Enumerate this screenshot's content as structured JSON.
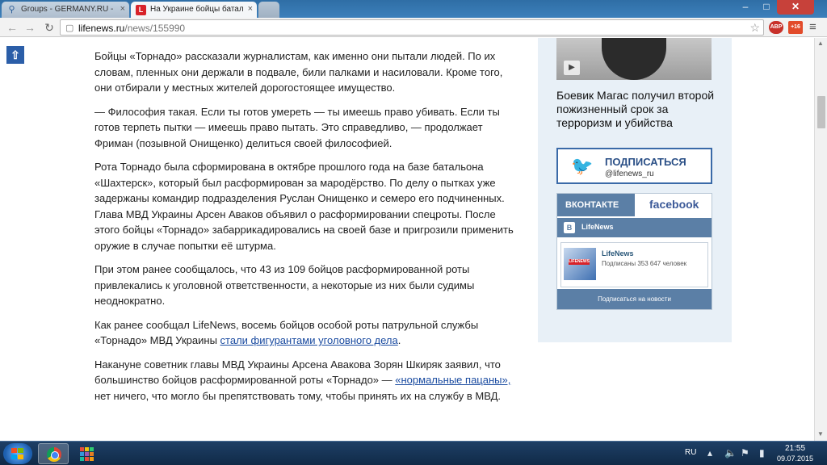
{
  "browser": {
    "tabs": [
      {
        "label": "Groups - GERMANY.RU - ",
        "favicon": "groups-icon"
      },
      {
        "label": "На Украине бойцы батал",
        "favicon": "L"
      }
    ],
    "url_host": "lifenews.ru",
    "url_path": "/news/155990",
    "extensions": {
      "adblock": "ABP",
      "plus_badge": "+16"
    }
  },
  "article": {
    "paragraphs": [
      "Бойцы «Торнадо» рассказали журналистам, как именно они пытали людей. По их словам, пленных они держали в подвале, били палками и насиловали. Кроме того, они отбирали у местных жителей дорогостоящее имущество.",
      "— Философия такая. Если ты готов умереть — ты имеешь право убивать. Если ты готов терпеть пытки — имеешь право пытать. Это справедливо, — продолжает Фриман (позывной Онищенко) делиться своей философией.",
      "Рота Торнадо была сформирована в октябре прошлого года на базе батальона «Шахтерск», который был расформирован за мародёрство. По делу о пытках уже задержаны командир подразделения Руслан Онищенко и семеро его подчиненных. Глава МВД Украины Арсен Аваков объявил о расформировании спецроты. После этого бойцы «Торнадо» забаррикадировались на своей базе и пригрозили применить оружие в случае попытки её штурма.",
      "При этом ранее сообщалось, что 43 из 109 бойцов расформированной роты привлекались к уголовной ответственности, а некоторые из них были судимы неоднократно."
    ],
    "p5_pre": "Как ранее сообщал LifeNews, восемь бойцов особой роты патрульной службы «Торнадо» МВД Украины ",
    "p5_link": "стали фигурантами уголовного дела",
    "p5_post": ".",
    "p6_pre": "Накануне советник главы МВД Украины Арсена Авакова Зорян Шкиряк заявил, что большинство бойцов расформированной роты «Торнадо» — ",
    "p6_link": "«нормальные пацаны», ",
    "p6_post": "нет ничего, что могло бы препятствовать тому, чтобы принять их на службу в МВД."
  },
  "sidebar": {
    "headline": "Боевик Магас получил второй пожизненный срок за терроризм и убийства",
    "twitter": {
      "title": "ПОДПИСАТЬСЯ",
      "handle": "@lifenews_ru"
    },
    "social": {
      "tab_vk": "ВКОНТАКТЕ",
      "tab_fb": "facebook",
      "vk_logo": "B",
      "vk_header": "LifeNews",
      "avatar_text": "LIFENEWS",
      "group_name": "LifeNews",
      "subscribers": "Подписаны 353 647 человек",
      "subscribe_button": "Подписаться на новости"
    }
  },
  "taskbar": {
    "lang": "RU",
    "time": "21:55",
    "date": "09.07.2015"
  },
  "colors": {
    "accent": "#2b5ea8",
    "vk": "#5b7fa6",
    "link": "#1a4ba0"
  }
}
